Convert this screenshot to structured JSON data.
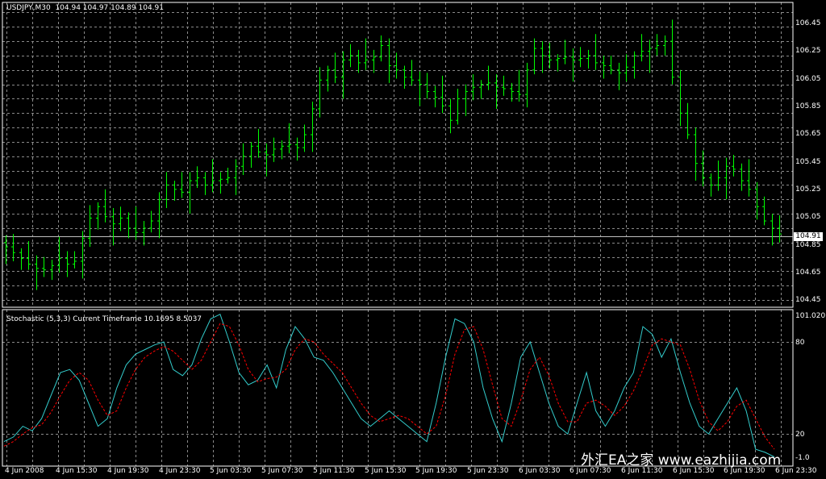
{
  "main_panel": {
    "title": "USDJPY,M30",
    "ohlc": "104.94 104.97 104.89 104.91",
    "current_price_label": "104.91",
    "y_ticks": [
      "106.45",
      "106.25",
      "106.05",
      "105.85",
      "105.65",
      "105.45",
      "105.25",
      "105.05",
      "104.85",
      "104.65",
      "104.45"
    ]
  },
  "indicator_panel": {
    "title": "Stochastic (5,3,3) Current Timeframe 10.1695 8.5037",
    "y_ticks": [
      "101.0207",
      "80",
      "20",
      "-1.0"
    ]
  },
  "x_ticks": [
    "4 Jun 2008",
    "4 Jun 15:30",
    "4 Jun 19:30",
    "4 Jun 23:30",
    "5 Jun 03:30",
    "5 Jun 07:30",
    "5 Jun 11:30",
    "5 Jun 15:30",
    "5 Jun 19:30",
    "5 Jun 23:30",
    "6 Jun 03:30",
    "6 Jun 07:30",
    "6 Jun 11:30",
    "6 Jun 15:30",
    "6 Jun 19:30",
    "6 Jun 23:30"
  ],
  "watermark": "外汇EA之家 www.eazhijia.com",
  "colors": {
    "background": "#000000",
    "bars": "#00ff00",
    "main_line": "#33cccc",
    "signal_line": "#ff0000",
    "grid": "#8a8a8a",
    "frame": "#ffffff"
  },
  "chart_data": [
    {
      "type": "ohlc",
      "symbol": "USDJPY",
      "timeframe": "M30",
      "ylim": [
        104.4,
        106.52
      ],
      "close": [
        104.82,
        104.78,
        104.74,
        104.7,
        104.67,
        104.66,
        104.69,
        104.74,
        104.7,
        104.72,
        104.88,
        105.02,
        105.1,
        105.03,
        104.98,
        105.02,
        104.95,
        104.92,
        104.95,
        105.0,
        105.15,
        105.25,
        105.22,
        105.2,
        105.28,
        105.3,
        105.25,
        105.28,
        105.29,
        105.3,
        105.38,
        105.45,
        105.52,
        105.48,
        105.46,
        105.5,
        105.52,
        105.53,
        105.51,
        105.6,
        105.78,
        105.98,
        106.05,
        106.0,
        106.12,
        106.15,
        106.1,
        106.12,
        106.14,
        106.22,
        106.08,
        106.05,
        106.0,
        105.98,
        105.95,
        105.9,
        105.86,
        105.8,
        105.7,
        105.85,
        105.9,
        105.93,
        105.95,
        105.96,
        105.93,
        105.92,
        105.9,
        105.88,
        106.05,
        106.2,
        106.15,
        106.12,
        106.13,
        106.14,
        106.12,
        106.13,
        106.15,
        106.1,
        106.08,
        106.05,
        106.03,
        106.07,
        106.15,
        106.18,
        106.2,
        106.22,
        106.25,
        106.0,
        105.75,
        105.6,
        105.4,
        105.3,
        105.25,
        105.3,
        105.38,
        105.36,
        105.28,
        105.22,
        105.1,
        105.0,
        104.95,
        104.91
      ]
    },
    {
      "type": "line",
      "title": "Stochastic (5,3,3) Current Timeframe 10.1695 8.5037",
      "ylim": [
        -1.0,
        101.0207
      ],
      "series": [
        {
          "values": [
            15,
            18,
            25,
            22,
            30,
            45,
            60,
            62,
            55,
            40,
            25,
            30,
            50,
            65,
            72,
            75,
            78,
            80,
            62,
            58,
            65,
            82,
            95,
            98,
            80,
            60,
            52,
            55,
            65,
            50,
            75,
            90,
            82,
            70,
            68,
            60,
            50,
            40,
            30,
            25,
            30,
            35,
            30,
            25,
            20,
            15,
            40,
            70,
            95,
            92,
            80,
            50,
            30,
            15,
            40,
            70,
            80,
            60,
            40,
            25,
            20,
            40,
            60,
            35,
            25,
            35,
            50,
            60,
            90,
            85,
            70,
            82,
            60,
            40,
            25,
            20,
            30,
            40,
            50,
            35,
            10,
            8,
            5
          ]
        },
        {
          "values": [
            12,
            15,
            20,
            24,
            26,
            34,
            45,
            55,
            60,
            55,
            42,
            32,
            35,
            50,
            62,
            70,
            74,
            77,
            74,
            68,
            62,
            68,
            80,
            92,
            90,
            78,
            62,
            54,
            56,
            57,
            62,
            75,
            82,
            80,
            72,
            66,
            60,
            50,
            40,
            32,
            28,
            30,
            32,
            30,
            25,
            20,
            25,
            45,
            72,
            88,
            90,
            75,
            52,
            30,
            25,
            42,
            62,
            70,
            58,
            40,
            28,
            28,
            40,
            42,
            38,
            32,
            38,
            48,
            62,
            78,
            82,
            80,
            78,
            62,
            42,
            28,
            22,
            28,
            38,
            42,
            30,
            18,
            10
          ]
        }
      ]
    }
  ]
}
